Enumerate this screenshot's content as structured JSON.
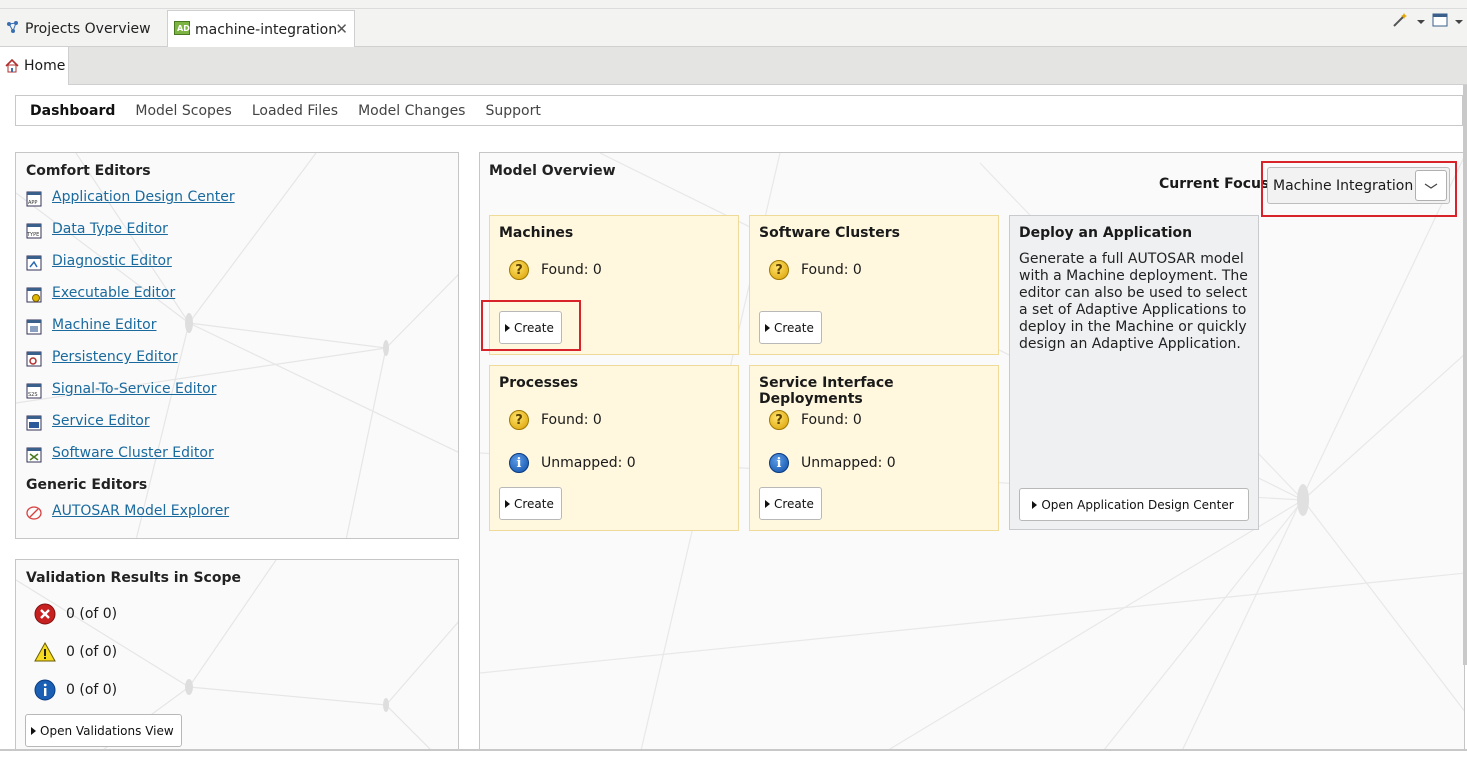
{
  "window_tabs": [
    {
      "label": "Projects Overview",
      "icon": "project-tree-icon"
    },
    {
      "label": "machine-integration",
      "icon": "ad-file-icon"
    }
  ],
  "close_glyph": "✕",
  "home_tab": {
    "label": "Home",
    "icon": "home-icon"
  },
  "nav_tabs": [
    "Dashboard",
    "Model Scopes",
    "Loaded Files",
    "Model Changes",
    "Support"
  ],
  "comfort_editors": {
    "title": "Comfort Editors",
    "items": [
      "Application Design Center",
      "Data Type Editor",
      "Diagnostic Editor",
      "Executable Editor",
      "Machine Editor",
      "Persistency Editor",
      "Signal-To-Service Editor",
      "Service Editor",
      "Software Cluster Editor"
    ]
  },
  "generic_editors": {
    "title": "Generic Editors",
    "items": [
      "AUTOSAR Model Explorer"
    ]
  },
  "validation": {
    "title": "Validation Results in Scope",
    "errors": "0 (of 0)",
    "warnings": "0 (of 0)",
    "infos": "0 (of 0)",
    "button": "Open Validations View"
  },
  "model_overview": {
    "title": "Model Overview",
    "focus_label": "Current Focus:",
    "focus_value": "Machine Integration",
    "cards": {
      "machines": {
        "title": "Machines",
        "found": "Found: 0",
        "button": "Create"
      },
      "software_clusters": {
        "title": "Software Clusters",
        "found": "Found: 0",
        "button": "Create"
      },
      "processes": {
        "title": "Processes",
        "found": "Found: 0",
        "unmapped": "Unmapped: 0",
        "button": "Create"
      },
      "service_interface_deployments": {
        "title": "Service Interface Deployments",
        "found": "Found: 0",
        "unmapped": "Unmapped: 0",
        "button": "Create"
      }
    },
    "deploy": {
      "title": "Deploy an Application",
      "text": "Generate a full AUTOSAR model with a Machine deployment. The editor can also be used to select a set of Adaptive Applications to deploy in the Machine or quickly design an Adaptive Application.",
      "button": "Open Application Design Center"
    }
  },
  "colors": {
    "link": "#1a6a9e",
    "highlight": "#d8232a",
    "card_bg": "#fff8df"
  }
}
